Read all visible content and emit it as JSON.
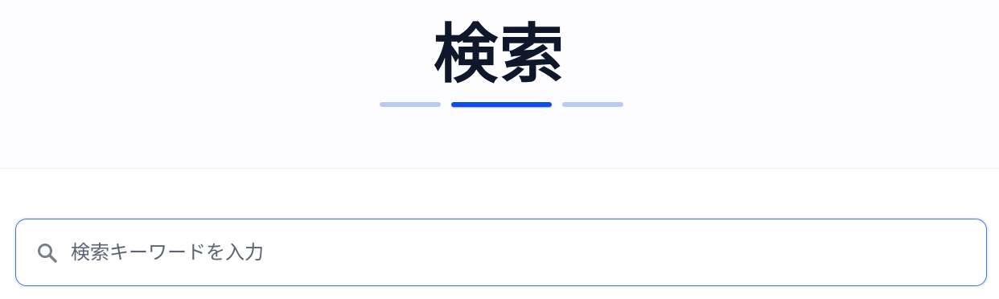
{
  "header": {
    "title": "検索"
  },
  "search": {
    "placeholder": "検索キーワードを入力",
    "value": "",
    "icon": "search-icon"
  },
  "colors": {
    "title": "#0f172a",
    "accent": "#0b4ff0",
    "accent_light": "#b8ccf2",
    "input_border": "#3d78dd",
    "placeholder": "#5b6472",
    "icon": "#7a8089"
  }
}
